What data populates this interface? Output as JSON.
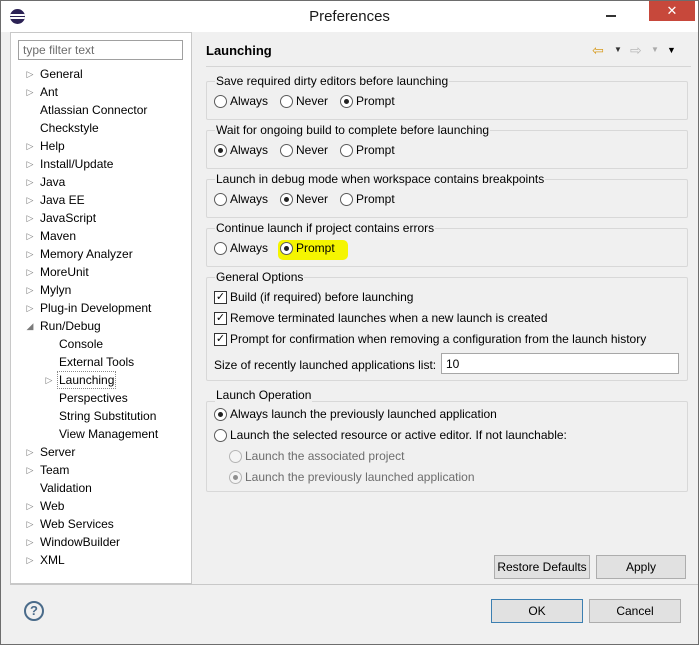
{
  "window": {
    "title": "Preferences",
    "close_glyph": "✕"
  },
  "filter": {
    "placeholder": "type filter text"
  },
  "tree": {
    "items": [
      {
        "label": "General",
        "expander": "▷"
      },
      {
        "label": "Ant",
        "expander": "▷"
      },
      {
        "label": "Atlassian Connector",
        "expander": ""
      },
      {
        "label": "Checkstyle",
        "expander": ""
      },
      {
        "label": "Help",
        "expander": "▷"
      },
      {
        "label": "Install/Update",
        "expander": "▷"
      },
      {
        "label": "Java",
        "expander": "▷"
      },
      {
        "label": "Java EE",
        "expander": "▷"
      },
      {
        "label": "JavaScript",
        "expander": "▷"
      },
      {
        "label": "Maven",
        "expander": "▷"
      },
      {
        "label": "Memory Analyzer",
        "expander": "▷"
      },
      {
        "label": "MoreUnit",
        "expander": "▷"
      },
      {
        "label": "Mylyn",
        "expander": "▷"
      },
      {
        "label": "Plug-in Development",
        "expander": "▷"
      },
      {
        "label": "Run/Debug",
        "expander": "◢"
      },
      {
        "label": "Console",
        "expander": ""
      },
      {
        "label": "External Tools",
        "expander": ""
      },
      {
        "label": "Launching",
        "expander": "▷"
      },
      {
        "label": "Perspectives",
        "expander": ""
      },
      {
        "label": "String Substitution",
        "expander": ""
      },
      {
        "label": "View Management",
        "expander": ""
      },
      {
        "label": "Server",
        "expander": "▷"
      },
      {
        "label": "Team",
        "expander": "▷"
      },
      {
        "label": "Validation",
        "expander": ""
      },
      {
        "label": "Web",
        "expander": "▷"
      },
      {
        "label": "Web Services",
        "expander": "▷"
      },
      {
        "label": "WindowBuilder",
        "expander": "▷"
      },
      {
        "label": "XML",
        "expander": "▷"
      }
    ]
  },
  "page": {
    "title": "Launching",
    "nav": {
      "back_glyph": "⇦",
      "forward_glyph": "⇨",
      "dropdown_glyph": "▼"
    }
  },
  "groups": {
    "save_dirty": {
      "title": "Save required dirty editors before launching",
      "options": [
        "Always",
        "Never",
        "Prompt"
      ],
      "selected": "Prompt"
    },
    "wait_build": {
      "title": "Wait for ongoing build to complete before launching",
      "options": [
        "Always",
        "Never",
        "Prompt"
      ],
      "selected": "Always"
    },
    "debug_mode": {
      "title": "Launch in debug mode when workspace contains breakpoints",
      "options": [
        "Always",
        "Never",
        "Prompt"
      ],
      "selected": "Never"
    },
    "continue_errors": {
      "title": "Continue launch if project contains errors",
      "options": [
        "Always",
        "Prompt"
      ],
      "selected": "Prompt"
    },
    "general": {
      "title": "General Options",
      "checks": [
        {
          "label": "Build (if required) before launching",
          "checked": true
        },
        {
          "label": "Remove terminated launches when a new launch is created",
          "checked": true
        },
        {
          "label": "Prompt for confirmation when removing a configuration from the launch history",
          "checked": true
        }
      ],
      "size_label": "Size of recently launched applications list:",
      "size_value": "10"
    },
    "launch_op": {
      "title": "Launch Operation",
      "opt_previous": "Always launch the previously launched application",
      "opt_selected": "Launch the selected resource or active editor. If not launchable:",
      "sub_associated": "Launch the associated project",
      "sub_previous": "Launch the previously launched application",
      "selected": "previous",
      "sub_selected": "previous"
    }
  },
  "buttons": {
    "restore_defaults": "Restore Defaults",
    "apply": "Apply",
    "ok": "OK",
    "cancel": "Cancel",
    "help": "?"
  },
  "colors": {
    "highlight": "#f5f500",
    "close_button": "#c7483b"
  }
}
